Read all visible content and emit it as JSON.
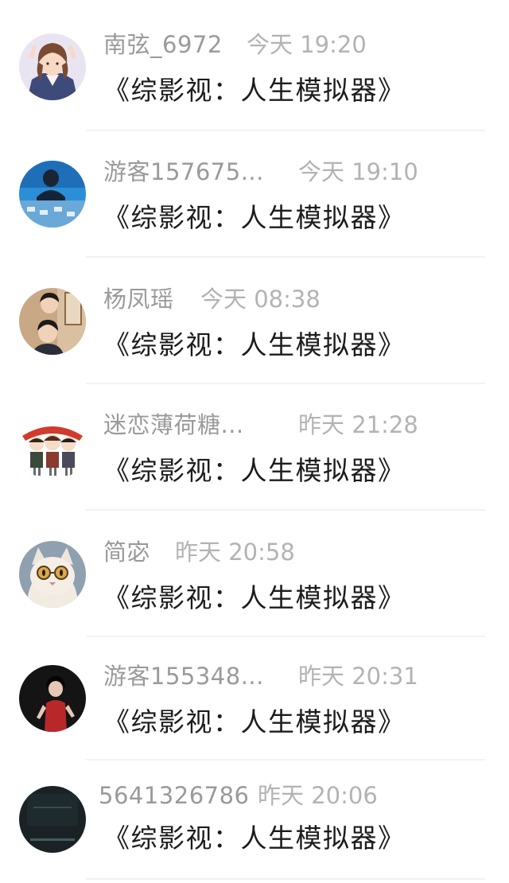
{
  "conversations": [
    {
      "name": "南弦_6972",
      "time": "今天 19:20",
      "message": "《综影视：人生模拟器》",
      "avatar": "anime-girl-avatar",
      "avatar_bg": "#3d4a7a"
    },
    {
      "name": "游客157675...",
      "time": "今天 19:10",
      "message": "《综影视：人生模拟器》",
      "avatar": "stage-photo-avatar",
      "avatar_bg": "#2a8fd6"
    },
    {
      "name": "杨凤瑶",
      "time": "今天 08:38",
      "message": "《综影视：人生模拟器》",
      "avatar": "two-men-portrait-avatar",
      "avatar_bg": "#b88a5e"
    },
    {
      "name": "迷恋薄荷糖...",
      "time": "昨天 21:28",
      "message": "《综影视：人生模拟器》",
      "avatar": "cartoon-girls-avatar",
      "avatar_bg": "#ffffff"
    },
    {
      "name": "简宓",
      "time": "昨天 20:58",
      "message": "《综影视：人生模拟器》",
      "avatar": "cat-with-glasses-avatar",
      "avatar_bg": "#8fa0b0"
    },
    {
      "name": "游客155348...",
      "time": "昨天 20:31",
      "message": "《综影视：人生模拟器》",
      "avatar": "woman-red-dress-avatar",
      "avatar_bg": "#141414"
    },
    {
      "name": "5641326786",
      "time": "昨天 20:06",
      "message": "《综影视：人生模拟器》",
      "avatar": "dark-screen-avatar",
      "avatar_bg": "#1a2226"
    }
  ]
}
